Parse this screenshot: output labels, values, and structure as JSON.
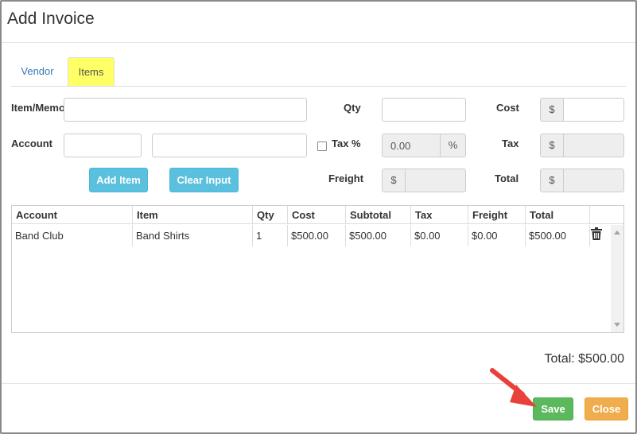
{
  "modal": {
    "title": "Add Invoice"
  },
  "tabs": [
    {
      "label": "Vendor"
    },
    {
      "label": "Items"
    }
  ],
  "form": {
    "item_memo_label": "Item/Memo",
    "qty_label": "Qty",
    "cost_label": "Cost",
    "account_label": "Account",
    "tax_pct_label": "Tax %",
    "tax_label": "Tax",
    "freight_label": "Freight",
    "total_label": "Total",
    "currency_symbol": "$",
    "percent_symbol": "%",
    "tax_pct_value": "0.00",
    "add_item_label": "Add Item",
    "clear_input_label": "Clear Input"
  },
  "grid": {
    "columns": [
      "Account",
      "Item",
      "Qty",
      "Cost",
      "Subtotal",
      "Tax",
      "Freight",
      "Total"
    ],
    "rows": [
      {
        "account": "Band Club",
        "item": "Band Shirts",
        "qty": "1",
        "cost": "$500.00",
        "subtotal": "$500.00",
        "tax": "$0.00",
        "freight": "$0.00",
        "total": "$500.00"
      }
    ]
  },
  "summary": {
    "total_text": "Total: $500.00"
  },
  "footer": {
    "save_label": "Save",
    "close_label": "Close"
  },
  "colors": {
    "tab_highlight": "#ffff66",
    "info": "#5bc0de",
    "success": "#5cb85c",
    "warning": "#f0ad4e",
    "annotation_arrow": "#e8403a"
  }
}
